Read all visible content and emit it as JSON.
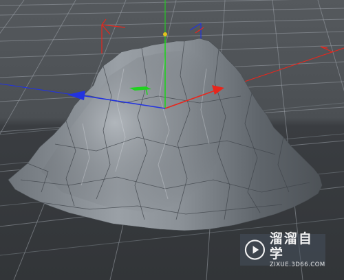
{
  "viewport": {
    "background": "#3a3d40",
    "grid_color": "#9aa1a7",
    "mesh_color": "#8a9097"
  },
  "gizmo": {
    "x_axis_color": "#e8261c",
    "y_axis_color": "#1fd21f",
    "z_axis_color": "#2233e0"
  },
  "watermark": {
    "brand": "溜溜自学",
    "url": "ZIXUE.3D66.COM",
    "logo_icon": "play-circle-icon"
  }
}
